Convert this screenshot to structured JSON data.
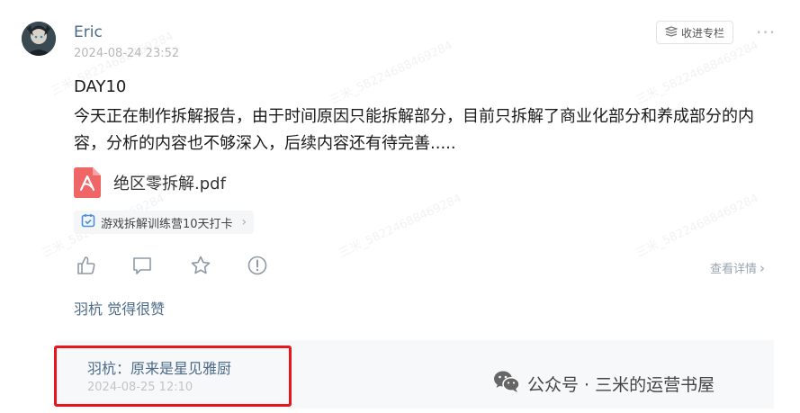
{
  "post": {
    "author": "Eric",
    "timestamp": "2024-08-24 23:52",
    "collect_label": "收进专栏",
    "more_label": "···",
    "title": "DAY10",
    "body": "今天正在制作拆解报告，由于时间原因只能拆解部分，目前只拆解了商业化部分和养成部分的内容，分析的内容也不够深入，后续内容还有待完善.....",
    "attachment": {
      "name": "绝区零拆解.pdf",
      "icon": "pdf-file-icon"
    },
    "tag": {
      "label": "游戏拆解训练营10天打卡",
      "icon": "checkin-calendar-icon"
    }
  },
  "actions": {
    "icons": [
      "thumbs-up-icon",
      "comment-icon",
      "star-icon",
      "report-icon"
    ],
    "detail_label": "查看详情"
  },
  "likes_text": "羽杭 觉得很赞",
  "comment": {
    "text": "羽杭：原来是星见雅厨",
    "timestamp": "2024-08-25 12:10"
  },
  "brand": {
    "text": "公众号 · 三米的运营书屋",
    "icon": "wechat-icon"
  },
  "watermark": "三米_58224688469284",
  "colors": {
    "name": "#4b6a88",
    "highlight": "#e8161c",
    "pdf": "#f06565",
    "tag_icon": "#4a90e2"
  }
}
